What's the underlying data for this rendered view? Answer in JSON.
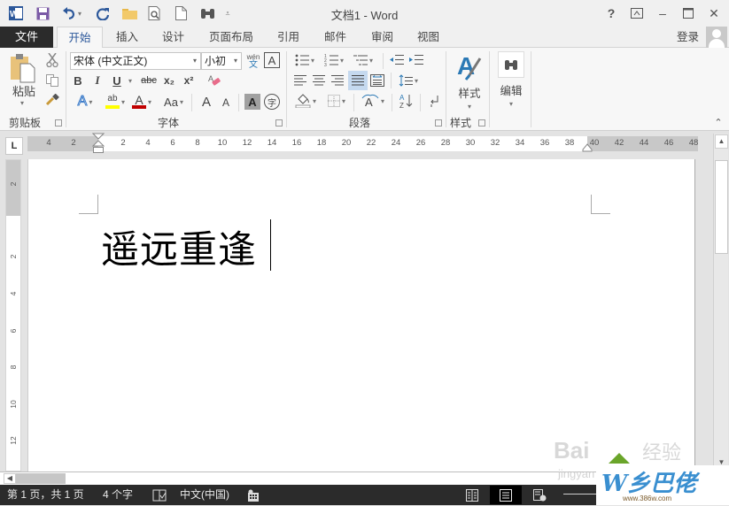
{
  "window": {
    "title": "文档1 - Word",
    "controls": [
      "help",
      "ribbon-display-options",
      "minimize",
      "maximize",
      "close"
    ],
    "control_glyphs": {
      "help": "?",
      "ribbon": "⊼",
      "minimize": "–",
      "maximize": "☐",
      "close": "✕"
    }
  },
  "quick_access": {
    "items": [
      "word-logo",
      "save",
      "undo",
      "redo",
      "open",
      "print-preview",
      "new",
      "find"
    ],
    "word_logo_color": "#2b579a"
  },
  "tabs": {
    "file": "文件",
    "items": [
      "开始",
      "插入",
      "设计",
      "页面布局",
      "引用",
      "邮件",
      "审阅",
      "视图"
    ],
    "active": "开始",
    "login": "登录"
  },
  "ribbon": {
    "clipboard": {
      "paste_label": "粘贴",
      "group_label": "剪贴板"
    },
    "font": {
      "font_name": "宋体 (中文正文)",
      "font_size": "小初",
      "phonetic_label": "wén",
      "phonetic_char": "文",
      "char_border": "A",
      "bold": "B",
      "italic": "I",
      "underline": "U",
      "strikethrough": "abc",
      "subscript": "x₂",
      "superscript": "x²",
      "text_effects": "A",
      "highlight": "ab",
      "font_color": "A",
      "change_case": "Aa",
      "grow_font": "A",
      "shrink_font": "A",
      "char_shading": "A",
      "enclose_char": "字",
      "group_label": "字体",
      "highlight_color": "#ffff00",
      "font_color_bar": "#c00000"
    },
    "paragraph": {
      "group_label": "段落",
      "sort": "A↓Z"
    },
    "styles": {
      "label": "样式",
      "group_label": "样式"
    },
    "editing": {
      "label": "编辑"
    }
  },
  "ruler": {
    "corner": "L",
    "h_ticks": [
      "4",
      "2",
      "2",
      "4",
      "6",
      "8",
      "10",
      "12",
      "14",
      "16",
      "18",
      "20",
      "22",
      "24",
      "26",
      "28",
      "30",
      "32",
      "34",
      "36",
      "38",
      "40",
      "42",
      "44",
      "46",
      "48"
    ],
    "v_ticks": [
      "2",
      "2",
      "4",
      "6",
      "8",
      "10",
      "12"
    ]
  },
  "document": {
    "text": "遥远重逢"
  },
  "status": {
    "page": "第 1 页，共 1 页",
    "words": "4 个字",
    "language": "中文(中国)",
    "views": [
      "read-mode",
      "print-layout",
      "web-layout"
    ],
    "active_view": "print-layout"
  },
  "watermark": {
    "baidu": "Bai",
    "jingyan": "经验",
    "jingyan_sub": "jingyan",
    "site_logo": "W乡巴佬",
    "site_url": "www.386w.com"
  }
}
